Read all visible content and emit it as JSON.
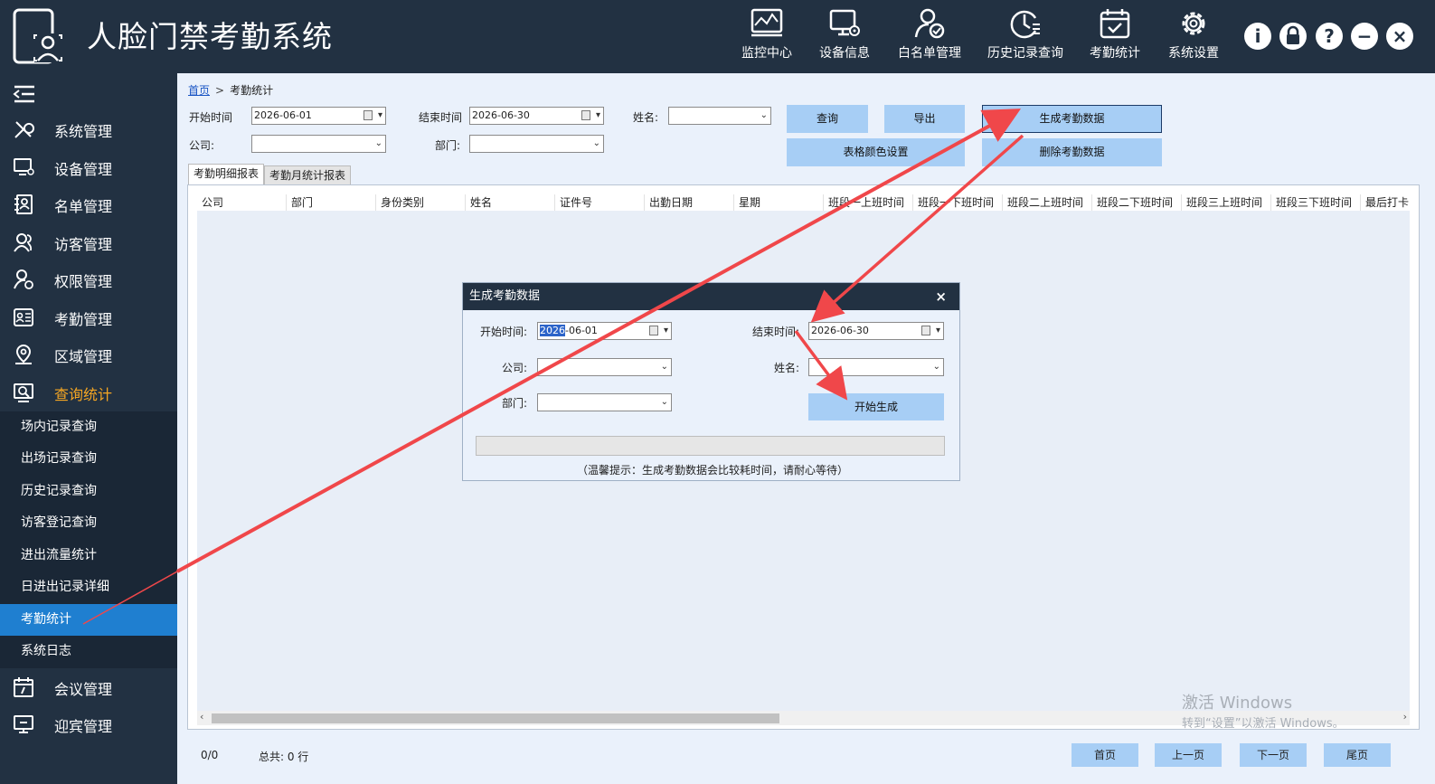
{
  "app": {
    "title": "人脸门禁考勤系统"
  },
  "topnav": [
    {
      "label": "监控中心",
      "icon": "monitor-icon"
    },
    {
      "label": "设备信息",
      "icon": "device-settings-icon"
    },
    {
      "label": "白名单管理",
      "icon": "whitelist-user-icon"
    },
    {
      "label": "历史记录查询",
      "icon": "history-clock-icon"
    },
    {
      "label": "考勤统计",
      "icon": "calendar-check-icon"
    },
    {
      "label": "系统设置",
      "icon": "gear-icon"
    }
  ],
  "window_buttons": {
    "info": "i",
    "lock": "lock",
    "help": "?",
    "minimize": "−",
    "close": "×"
  },
  "sidebar": {
    "items": [
      {
        "label": "系统管理",
        "icon": "tools-icon"
      },
      {
        "label": "设备管理",
        "icon": "device-icon"
      },
      {
        "label": "名单管理",
        "icon": "roster-icon"
      },
      {
        "label": "访客管理",
        "icon": "visitor-icon"
      },
      {
        "label": "权限管理",
        "icon": "permission-icon"
      },
      {
        "label": "考勤管理",
        "icon": "attendance-card-icon"
      },
      {
        "label": "区域管理",
        "icon": "location-pin-icon"
      },
      {
        "label": "查询统计",
        "icon": "query-stats-icon",
        "active": true
      },
      {
        "label": "会议管理",
        "icon": "meeting-calendar-icon"
      },
      {
        "label": "迎宾管理",
        "icon": "welcome-screen-icon"
      }
    ],
    "submenu": [
      {
        "label": "场内记录查询"
      },
      {
        "label": "出场记录查询"
      },
      {
        "label": "历史记录查询"
      },
      {
        "label": "访客登记查询"
      },
      {
        "label": "进出流量统计"
      },
      {
        "label": "日进出记录详细"
      },
      {
        "label": "考勤统计",
        "active": true
      },
      {
        "label": "系统日志"
      }
    ]
  },
  "breadcrumb": {
    "home": "首页",
    "separator": ">",
    "current": "考勤统计"
  },
  "filters": {
    "start_label": "开始时间",
    "start_value": "2026-06-01",
    "end_label": "结束时间",
    "end_value": "2026-06-30",
    "name_label": "姓名:",
    "name_value": "",
    "company_label": "公司:",
    "company_value": "",
    "dept_label": "部门:",
    "dept_value": ""
  },
  "buttons": {
    "query": "查询",
    "export": "导出",
    "generate": "生成考勤数据",
    "table_color": "表格颜色设置",
    "delete": "删除考勤数据"
  },
  "tabs": [
    {
      "label": "考勤明细报表",
      "active": true
    },
    {
      "label": "考勤月统计报表"
    }
  ],
  "table": {
    "columns": [
      "公司",
      "部门",
      "身份类别",
      "姓名",
      "证件号",
      "出勤日期",
      "星期",
      "班段一上班时间",
      "班段一下班时间",
      "班段二上班时间",
      "班段二下班时间",
      "班段三上班时间",
      "班段三下班时间",
      "最后打卡"
    ],
    "rows": []
  },
  "watermark": {
    "line1": "激活 Windows",
    "line2": "转到“设置”以激活 Windows。"
  },
  "footer": {
    "page_info": "0/0",
    "total": "总共: 0 行",
    "first": "首页",
    "prev": "上一页",
    "next": "下一页",
    "last": "尾页"
  },
  "dialog": {
    "title": "生成考勤数据",
    "close": "×",
    "start_label": "开始时间:",
    "start_value_selected": "2026",
    "start_value_rest": "-06-01",
    "end_label": "结束时间:",
    "end_value": "2026-06-30",
    "company_label": "公司:",
    "company_value": "",
    "name_label": "姓名:",
    "name_value": "",
    "dept_label": "部门:",
    "dept_value": "",
    "start_button": "开始生成",
    "tip": "（温馨提示：生成考勤数据会比较耗时间，请耐心等待）"
  },
  "colors": {
    "header_bg": "#223142",
    "accent_button": "#a7cef5",
    "active_submenu": "#1f7fd0",
    "active_text": "#f5a623",
    "arrow": "#f0474a"
  }
}
